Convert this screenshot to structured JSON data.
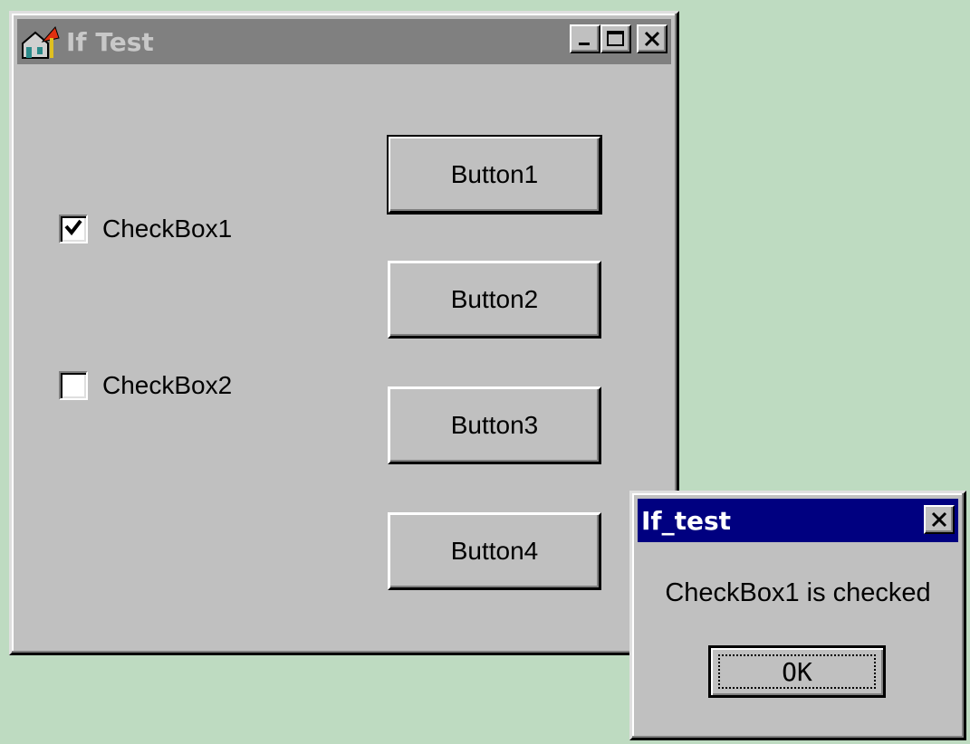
{
  "main_window": {
    "title": "If Test",
    "titlebar_color": "#808080",
    "icons": {
      "app": "house-arrow-icon",
      "minimize": "minimize-icon",
      "maximize": "maximize-icon",
      "close": "close-icon"
    }
  },
  "checkboxes": [
    {
      "label": "CheckBox1",
      "checked": true
    },
    {
      "label": "CheckBox2",
      "checked": false
    }
  ],
  "buttons": [
    {
      "label": "Button1"
    },
    {
      "label": "Button2"
    },
    {
      "label": "Button3"
    },
    {
      "label": "Button4"
    }
  ],
  "dialog": {
    "title": "If_test",
    "titlebar_color": "#000080",
    "message": "CheckBox1 is checked",
    "ok_label": "OK"
  },
  "colors": {
    "desktop": "#bedbc1",
    "face": "#c0c0c0"
  }
}
